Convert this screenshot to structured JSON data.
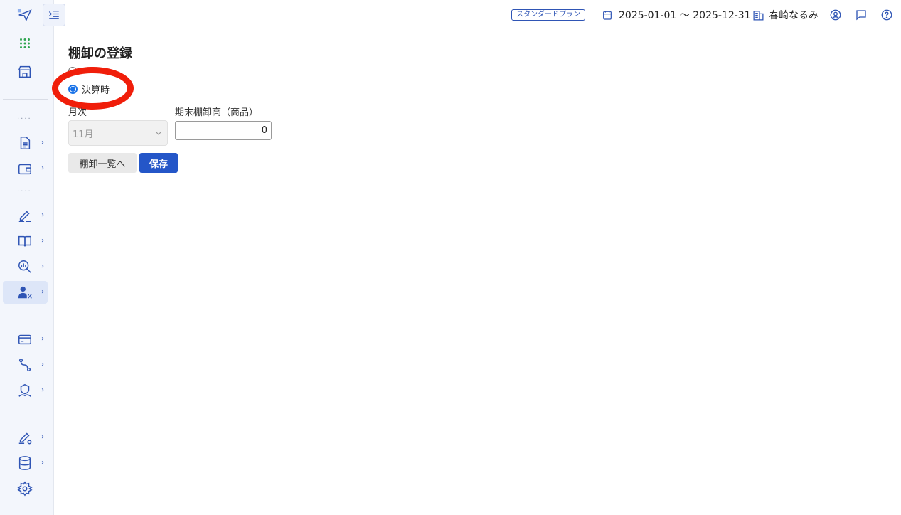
{
  "header": {
    "plan_badge": "スタンダードプラン",
    "period": "2025-01-01 〜 2025-12-31",
    "user_name": "春崎なるみ"
  },
  "page": {
    "title": "棚卸の登録",
    "radio_option_label": "決算時",
    "month_label": "月次",
    "month_value": "11月",
    "inventory_label": "期末棚卸高（商品）",
    "inventory_value": "0",
    "list_button": "棚卸一覧へ",
    "save_button": "保存"
  },
  "colors": {
    "accent": "#2f55b5",
    "save_button": "#2456c8",
    "highlight_annotation": "#f01e0a"
  }
}
